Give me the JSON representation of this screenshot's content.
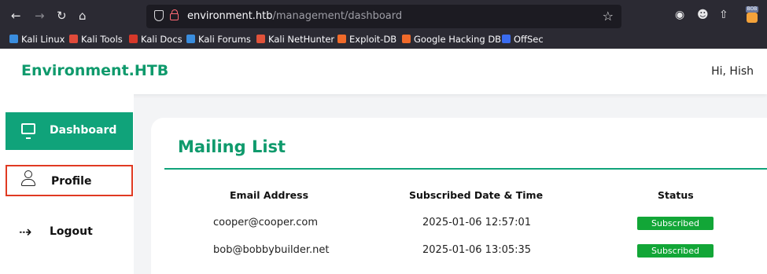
{
  "browser": {
    "url_host": "environment.htb",
    "url_path": "/management/dashboard",
    "ext_badge": "BOB",
    "bookmarks": [
      {
        "label": "Kali Linux",
        "color": "#3a8dde"
      },
      {
        "label": "Kali Tools",
        "color": "#e04a3a"
      },
      {
        "label": "Kali Docs",
        "color": "#d6382a"
      },
      {
        "label": "Kali Forums",
        "color": "#3a8dde"
      },
      {
        "label": "Kali NetHunter",
        "color": "#e0523a"
      },
      {
        "label": "Exploit-DB",
        "color": "#f06a2a"
      },
      {
        "label": "Google Hacking DB",
        "color": "#f06a2a"
      },
      {
        "label": "OffSec",
        "color": "#3a6cf0"
      }
    ]
  },
  "header": {
    "brand": "Environment.HTB",
    "greeting": "Hi, Hish"
  },
  "sidebar": {
    "items": [
      {
        "label": "Dashboard",
        "icon": "monitor-icon",
        "active": true
      },
      {
        "label": "Profile",
        "icon": "user-icon",
        "highlighted": true
      },
      {
        "label": "Logout",
        "icon": "logout-icon"
      }
    ]
  },
  "main": {
    "title": "Mailing List",
    "columns": [
      "Email Address",
      "Subscribed Date & Time",
      "Status"
    ],
    "rows": [
      {
        "email": "cooper@cooper.com",
        "date": "2025-01-06 12:57:01",
        "status": "Subscribed"
      },
      {
        "email": "bob@bobbybuilder.net",
        "date": "2025-01-06 13:05:35",
        "status": "Subscribed"
      }
    ]
  },
  "colors": {
    "brand": "#0f9a6c",
    "accent": "#10a37a",
    "status_green": "#12a637",
    "highlight": "#e03a22"
  }
}
